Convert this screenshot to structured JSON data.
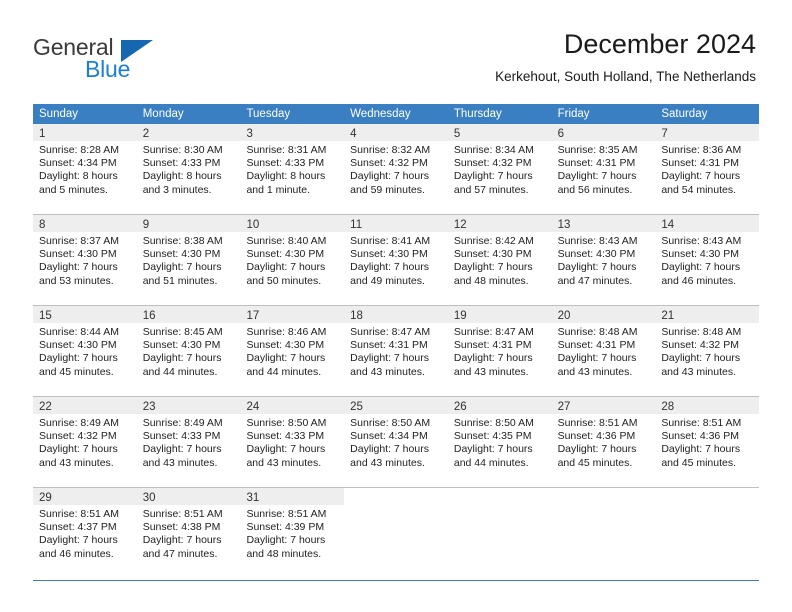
{
  "brand": {
    "name_part1": "General",
    "name_part2": "Blue",
    "accent_color": "#1b7fd4",
    "triangle_color": "#1568b0"
  },
  "header": {
    "month_year": "December 2024",
    "location": "Kerkehout, South Holland, The Netherlands"
  },
  "calendar": {
    "header_bg": "#3a7fc1",
    "weekdays": [
      "Sunday",
      "Monday",
      "Tuesday",
      "Wednesday",
      "Thursday",
      "Friday",
      "Saturday"
    ],
    "weeks": [
      [
        {
          "day": "1",
          "sunrise": "Sunrise: 8:28 AM",
          "sunset": "Sunset: 4:34 PM",
          "daylight_line1": "Daylight: 8 hours",
          "daylight_line2": "and 5 minutes."
        },
        {
          "day": "2",
          "sunrise": "Sunrise: 8:30 AM",
          "sunset": "Sunset: 4:33 PM",
          "daylight_line1": "Daylight: 8 hours",
          "daylight_line2": "and 3 minutes."
        },
        {
          "day": "3",
          "sunrise": "Sunrise: 8:31 AM",
          "sunset": "Sunset: 4:33 PM",
          "daylight_line1": "Daylight: 8 hours",
          "daylight_line2": "and 1 minute."
        },
        {
          "day": "4",
          "sunrise": "Sunrise: 8:32 AM",
          "sunset": "Sunset: 4:32 PM",
          "daylight_line1": "Daylight: 7 hours",
          "daylight_line2": "and 59 minutes."
        },
        {
          "day": "5",
          "sunrise": "Sunrise: 8:34 AM",
          "sunset": "Sunset: 4:32 PM",
          "daylight_line1": "Daylight: 7 hours",
          "daylight_line2": "and 57 minutes."
        },
        {
          "day": "6",
          "sunrise": "Sunrise: 8:35 AM",
          "sunset": "Sunset: 4:31 PM",
          "daylight_line1": "Daylight: 7 hours",
          "daylight_line2": "and 56 minutes."
        },
        {
          "day": "7",
          "sunrise": "Sunrise: 8:36 AM",
          "sunset": "Sunset: 4:31 PM",
          "daylight_line1": "Daylight: 7 hours",
          "daylight_line2": "and 54 minutes."
        }
      ],
      [
        {
          "day": "8",
          "sunrise": "Sunrise: 8:37 AM",
          "sunset": "Sunset: 4:30 PM",
          "daylight_line1": "Daylight: 7 hours",
          "daylight_line2": "and 53 minutes."
        },
        {
          "day": "9",
          "sunrise": "Sunrise: 8:38 AM",
          "sunset": "Sunset: 4:30 PM",
          "daylight_line1": "Daylight: 7 hours",
          "daylight_line2": "and 51 minutes."
        },
        {
          "day": "10",
          "sunrise": "Sunrise: 8:40 AM",
          "sunset": "Sunset: 4:30 PM",
          "daylight_line1": "Daylight: 7 hours",
          "daylight_line2": "and 50 minutes."
        },
        {
          "day": "11",
          "sunrise": "Sunrise: 8:41 AM",
          "sunset": "Sunset: 4:30 PM",
          "daylight_line1": "Daylight: 7 hours",
          "daylight_line2": "and 49 minutes."
        },
        {
          "day": "12",
          "sunrise": "Sunrise: 8:42 AM",
          "sunset": "Sunset: 4:30 PM",
          "daylight_line1": "Daylight: 7 hours",
          "daylight_line2": "and 48 minutes."
        },
        {
          "day": "13",
          "sunrise": "Sunrise: 8:43 AM",
          "sunset": "Sunset: 4:30 PM",
          "daylight_line1": "Daylight: 7 hours",
          "daylight_line2": "and 47 minutes."
        },
        {
          "day": "14",
          "sunrise": "Sunrise: 8:43 AM",
          "sunset": "Sunset: 4:30 PM",
          "daylight_line1": "Daylight: 7 hours",
          "daylight_line2": "and 46 minutes."
        }
      ],
      [
        {
          "day": "15",
          "sunrise": "Sunrise: 8:44 AM",
          "sunset": "Sunset: 4:30 PM",
          "daylight_line1": "Daylight: 7 hours",
          "daylight_line2": "and 45 minutes."
        },
        {
          "day": "16",
          "sunrise": "Sunrise: 8:45 AM",
          "sunset": "Sunset: 4:30 PM",
          "daylight_line1": "Daylight: 7 hours",
          "daylight_line2": "and 44 minutes."
        },
        {
          "day": "17",
          "sunrise": "Sunrise: 8:46 AM",
          "sunset": "Sunset: 4:30 PM",
          "daylight_line1": "Daylight: 7 hours",
          "daylight_line2": "and 44 minutes."
        },
        {
          "day": "18",
          "sunrise": "Sunrise: 8:47 AM",
          "sunset": "Sunset: 4:31 PM",
          "daylight_line1": "Daylight: 7 hours",
          "daylight_line2": "and 43 minutes."
        },
        {
          "day": "19",
          "sunrise": "Sunrise: 8:47 AM",
          "sunset": "Sunset: 4:31 PM",
          "daylight_line1": "Daylight: 7 hours",
          "daylight_line2": "and 43 minutes."
        },
        {
          "day": "20",
          "sunrise": "Sunrise: 8:48 AM",
          "sunset": "Sunset: 4:31 PM",
          "daylight_line1": "Daylight: 7 hours",
          "daylight_line2": "and 43 minutes."
        },
        {
          "day": "21",
          "sunrise": "Sunrise: 8:48 AM",
          "sunset": "Sunset: 4:32 PM",
          "daylight_line1": "Daylight: 7 hours",
          "daylight_line2": "and 43 minutes."
        }
      ],
      [
        {
          "day": "22",
          "sunrise": "Sunrise: 8:49 AM",
          "sunset": "Sunset: 4:32 PM",
          "daylight_line1": "Daylight: 7 hours",
          "daylight_line2": "and 43 minutes."
        },
        {
          "day": "23",
          "sunrise": "Sunrise: 8:49 AM",
          "sunset": "Sunset: 4:33 PM",
          "daylight_line1": "Daylight: 7 hours",
          "daylight_line2": "and 43 minutes."
        },
        {
          "day": "24",
          "sunrise": "Sunrise: 8:50 AM",
          "sunset": "Sunset: 4:33 PM",
          "daylight_line1": "Daylight: 7 hours",
          "daylight_line2": "and 43 minutes."
        },
        {
          "day": "25",
          "sunrise": "Sunrise: 8:50 AM",
          "sunset": "Sunset: 4:34 PM",
          "daylight_line1": "Daylight: 7 hours",
          "daylight_line2": "and 43 minutes."
        },
        {
          "day": "26",
          "sunrise": "Sunrise: 8:50 AM",
          "sunset": "Sunset: 4:35 PM",
          "daylight_line1": "Daylight: 7 hours",
          "daylight_line2": "and 44 minutes."
        },
        {
          "day": "27",
          "sunrise": "Sunrise: 8:51 AM",
          "sunset": "Sunset: 4:36 PM",
          "daylight_line1": "Daylight: 7 hours",
          "daylight_line2": "and 45 minutes."
        },
        {
          "day": "28",
          "sunrise": "Sunrise: 8:51 AM",
          "sunset": "Sunset: 4:36 PM",
          "daylight_line1": "Daylight: 7 hours",
          "daylight_line2": "and 45 minutes."
        }
      ],
      [
        {
          "day": "29",
          "sunrise": "Sunrise: 8:51 AM",
          "sunset": "Sunset: 4:37 PM",
          "daylight_line1": "Daylight: 7 hours",
          "daylight_line2": "and 46 minutes."
        },
        {
          "day": "30",
          "sunrise": "Sunrise: 8:51 AM",
          "sunset": "Sunset: 4:38 PM",
          "daylight_line1": "Daylight: 7 hours",
          "daylight_line2": "and 47 minutes."
        },
        {
          "day": "31",
          "sunrise": "Sunrise: 8:51 AM",
          "sunset": "Sunset: 4:39 PM",
          "daylight_line1": "Daylight: 7 hours",
          "daylight_line2": "and 48 minutes."
        },
        {
          "day": "",
          "sunrise": "",
          "sunset": "",
          "daylight_line1": "",
          "daylight_line2": ""
        },
        {
          "day": "",
          "sunrise": "",
          "sunset": "",
          "daylight_line1": "",
          "daylight_line2": ""
        },
        {
          "day": "",
          "sunrise": "",
          "sunset": "",
          "daylight_line1": "",
          "daylight_line2": ""
        },
        {
          "day": "",
          "sunrise": "",
          "sunset": "",
          "daylight_line1": "",
          "daylight_line2": ""
        }
      ]
    ]
  }
}
